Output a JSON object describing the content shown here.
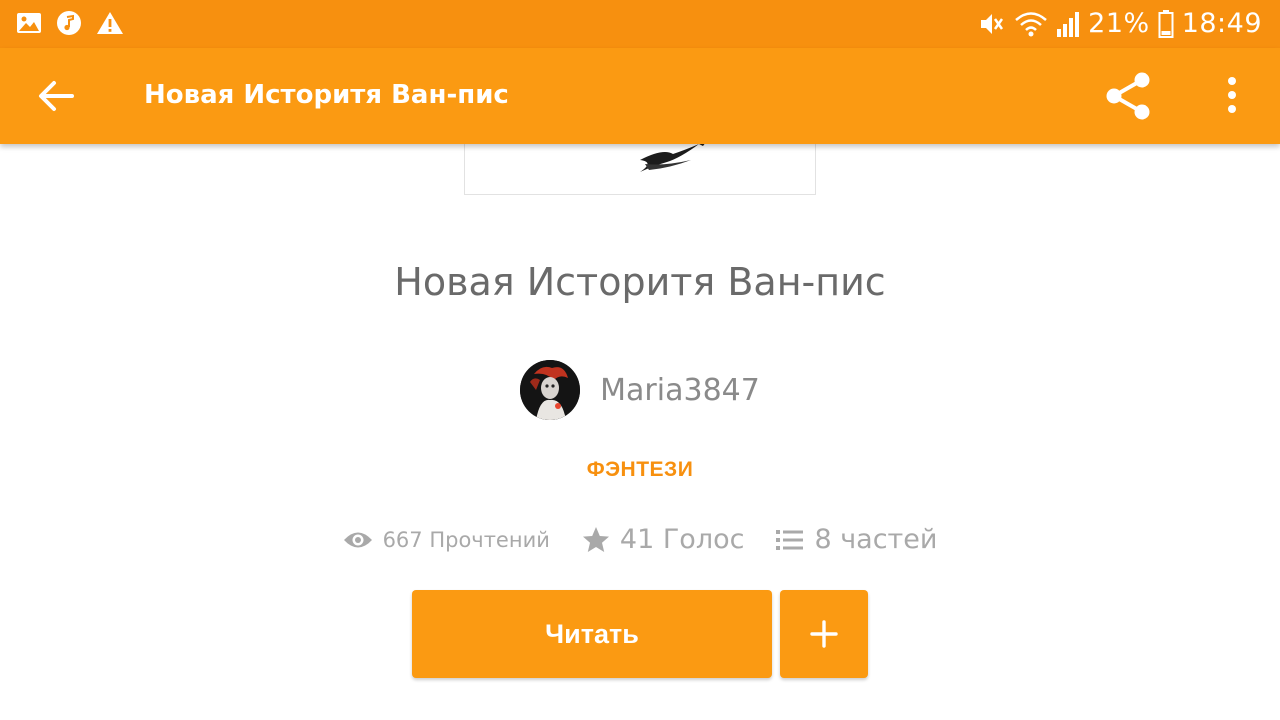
{
  "status_bar": {
    "battery_text": "21%",
    "time": "18:49",
    "left_icons": [
      "gallery-icon",
      "music-icon",
      "warning-icon"
    ],
    "right_icons": [
      "mute-icon",
      "wifi-icon",
      "signal-icon",
      "battery-icon"
    ]
  },
  "app_bar": {
    "title": "Новая Историтя Ван-пис",
    "icons": [
      "back-arrow-icon",
      "share-icon",
      "more-vert-icon"
    ]
  },
  "story": {
    "title": "Новая Историтя Ван-пис",
    "author": "Maria3847",
    "genre": "ФЭНТЕЗИ",
    "reads": "667 Прочтений",
    "votes": "41 Голос",
    "parts": "8 частей"
  },
  "actions": {
    "read_label": "Читать",
    "add_icon": "plus-icon"
  },
  "colors": {
    "status_bar": "#f7900f",
    "app_bar": "#fb9a12",
    "accent": "#f7900f",
    "title_text": "#6a6a6a",
    "muted_text": "#a9a9a9"
  }
}
